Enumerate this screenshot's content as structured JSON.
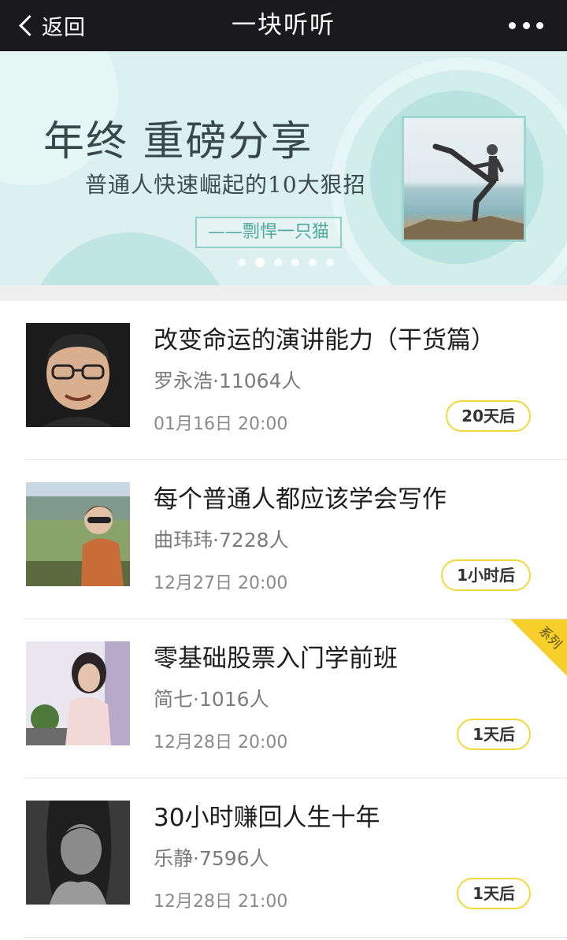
{
  "navbar": {
    "back_label": "返回",
    "title": "一块听听",
    "more_icon": "more-dots-icon"
  },
  "banner": {
    "title": "年终 重磅分享",
    "subtitle": "普通人快速崛起的10大狠招",
    "author": "——剽悍一只猫",
    "slide_count": 6,
    "active_slide": 2,
    "colors": {
      "background": "#dcf1ef",
      "accent": "#8fcfc7"
    }
  },
  "courses": [
    {
      "title": "改变命运的演讲能力（干货篇）",
      "meta": "罗永浩·11064人",
      "time": "01月16日 20:00",
      "countdown": "20天后",
      "series": false
    },
    {
      "title": "每个普通人都应该学会写作",
      "meta": "曲玮玮·7228人",
      "time": "12月27日 20:00",
      "countdown": "1小时后",
      "series": false
    },
    {
      "title": "零基础股票入门学前班",
      "meta": "简七·1016人",
      "time": "12月28日 20:00",
      "countdown": "1天后",
      "series": true,
      "series_label": "系列"
    },
    {
      "title": "30小时赚回人生十年",
      "meta": "乐静·7596人",
      "time": "12月28日 21:00",
      "countdown": "1天后",
      "series": false
    }
  ],
  "colors": {
    "navbar": "#1a1a1e",
    "countdown_border": "#f2d83a",
    "series_ribbon": "#f7cf2a"
  }
}
